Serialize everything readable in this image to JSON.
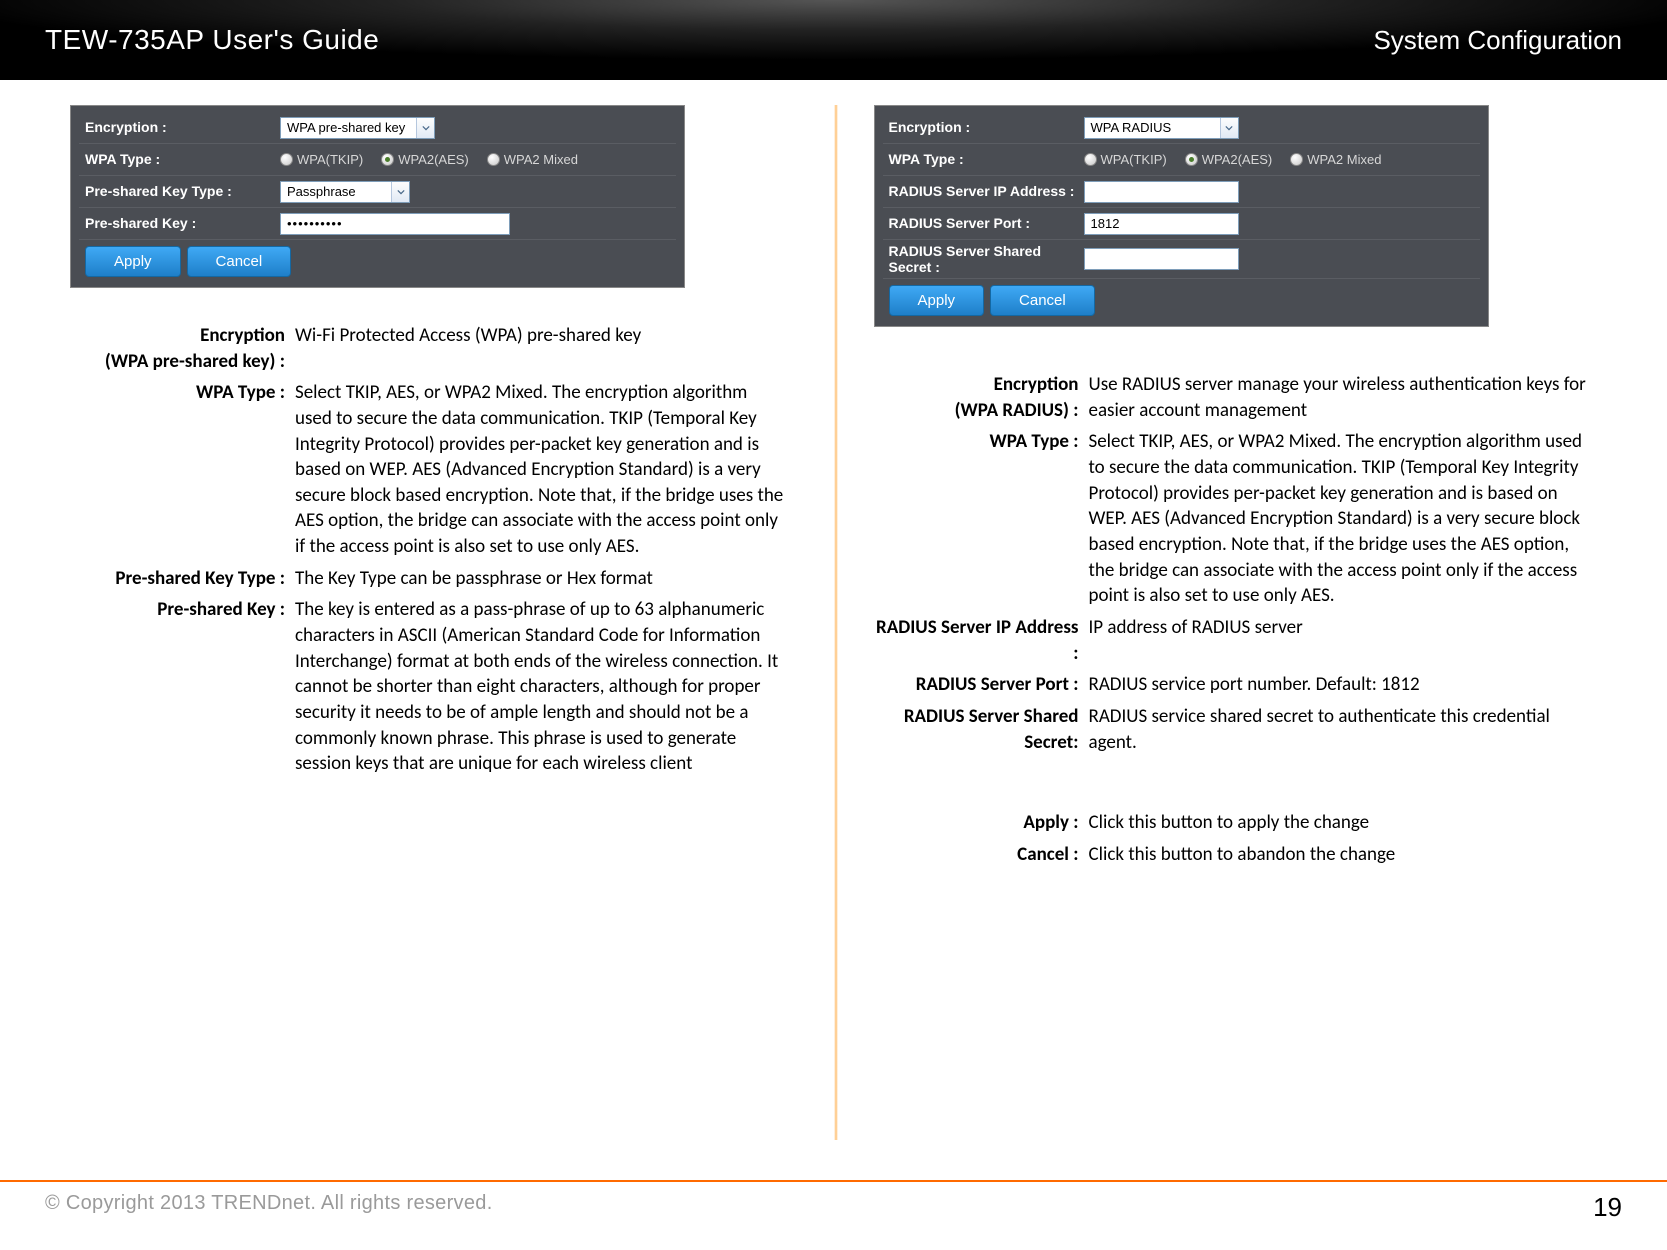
{
  "header": {
    "title": "TEW-735AP User's Guide",
    "section": "System Configuration"
  },
  "left": {
    "panel": {
      "rows": {
        "encryption": {
          "label": "Encryption :",
          "value": "WPA pre-shared key"
        },
        "wpaType": {
          "label": "WPA Type :",
          "options": [
            "WPA(TKIP)",
            "WPA2(AES)",
            "WPA2 Mixed"
          ]
        },
        "pskType": {
          "label": "Pre-shared Key Type :",
          "value": "Passphrase"
        },
        "psk": {
          "label": "Pre-shared Key :",
          "value": "••••••••••"
        }
      },
      "buttons": {
        "apply": "Apply",
        "cancel": "Cancel"
      }
    },
    "defs": [
      {
        "term": "Encryption\n(WPA pre-shared key) :",
        "desc": "Wi-Fi Protected Access (WPA) pre-shared key"
      },
      {
        "term": "WPA Type :",
        "desc": "Select TKIP, AES, or WPA2 Mixed. The encryption algorithm used to secure the data communication. TKIP (Temporal Key Integrity Protocol) provides per-packet key generation and is based on WEP. AES (Advanced Encryption Standard) is a very secure block based encryption. Note that, if the bridge uses the AES option, the bridge can associate with the access point only if the access point is also set to use only AES."
      },
      {
        "term": "Pre-shared Key Type :",
        "desc": "The Key Type can be passphrase or Hex format"
      },
      {
        "term": "Pre-shared Key :",
        "desc": "The key is entered as a pass-phrase of up to 63 alphanumeric characters in ASCII (American Standard Code for Information Interchange) format at both ends of the wireless connection. It cannot be shorter than eight characters, although for proper security it needs to be of ample length and should not be a commonly known phrase. This phrase is used to generate session keys that are unique for each wireless client"
      }
    ]
  },
  "right": {
    "panel": {
      "rows": {
        "encryption": {
          "label": "Encryption :",
          "value": "WPA RADIUS"
        },
        "wpaType": {
          "label": "WPA Type :",
          "options": [
            "WPA(TKIP)",
            "WPA2(AES)",
            "WPA2 Mixed"
          ]
        },
        "radiusIp": {
          "label": "RADIUS Server IP Address :",
          "value": ""
        },
        "radiusPort": {
          "label": "RADIUS Server Port :",
          "value": "1812"
        },
        "radiusSecret": {
          "label": "RADIUS Server Shared Secret :",
          "value": ""
        }
      },
      "buttons": {
        "apply": "Apply",
        "cancel": "Cancel"
      }
    },
    "defs": [
      {
        "term": "Encryption\n(WPA RADIUS) :",
        "desc": "Use RADIUS server manage your wireless authentication keys for easier account management"
      },
      {
        "term": "WPA Type :",
        "desc": "Select TKIP, AES, or WPA2 Mixed. The encryption algorithm used to secure the data communication. TKIP (Temporal Key Integrity Protocol) provides per-packet key generation and is based on WEP. AES (Advanced Encryption Standard) is a very secure block based encryption. Note that, if the bridge uses the AES option, the bridge can associate with the access point only if the access point is also set to use only AES."
      },
      {
        "term": "RADIUS Server IP Address :",
        "desc": "IP address of RADIUS server"
      },
      {
        "term": "RADIUS Server Port :",
        "desc": "RADIUS service port number. Default: 1812"
      },
      {
        "term": "RADIUS Server Shared Secret:",
        "desc": "RADIUS service shared secret to authenticate this credential agent."
      }
    ],
    "defs2": [
      {
        "term": "Apply :",
        "desc": "Click this button to apply the change"
      },
      {
        "term": "Cancel :",
        "desc": "Click this button to abandon the change"
      }
    ]
  },
  "footer": {
    "copyright": "© Copyright 2013 TRENDnet. All rights reserved.",
    "page": "19"
  }
}
